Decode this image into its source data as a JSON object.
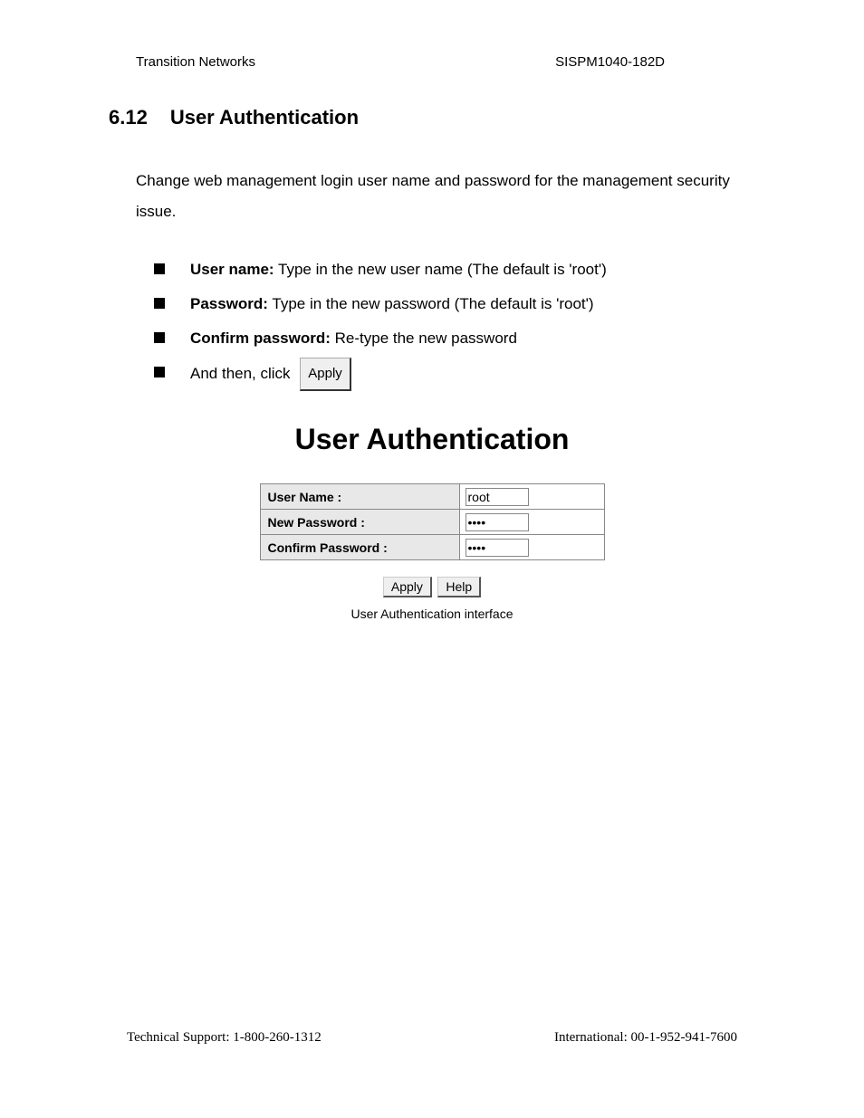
{
  "header": {
    "left": "Transition Networks",
    "right": "SISPM1040-182D"
  },
  "section": {
    "number": "6.12",
    "title": "User Authentication",
    "intro": "Change web management login user name and password for the management security issue."
  },
  "bullets": {
    "username_label": "User name:",
    "username_text": " Type in the new user name (The default is 'root')",
    "password_label": "Password:",
    "password_text": " Type in the new password (The default is 'root')",
    "confirm_label": "Confirm password:",
    "confirm_text": " Re-type the new password",
    "click_prefix": "And then, click ",
    "apply_btn": "Apply"
  },
  "ui": {
    "title": "User Authentication",
    "rows": {
      "username_label": "User Name :",
      "username_value": "root",
      "newpass_label": "New Password :",
      "newpass_value": "••••",
      "confirm_label": "Confirm Password :",
      "confirm_value": "••••"
    },
    "buttons": {
      "apply": "Apply",
      "help": "Help"
    },
    "caption": "User Authentication interface"
  },
  "footer": {
    "left": "Technical Support: 1-800-260-1312",
    "right": "International: 00-1-952-941-7600"
  }
}
